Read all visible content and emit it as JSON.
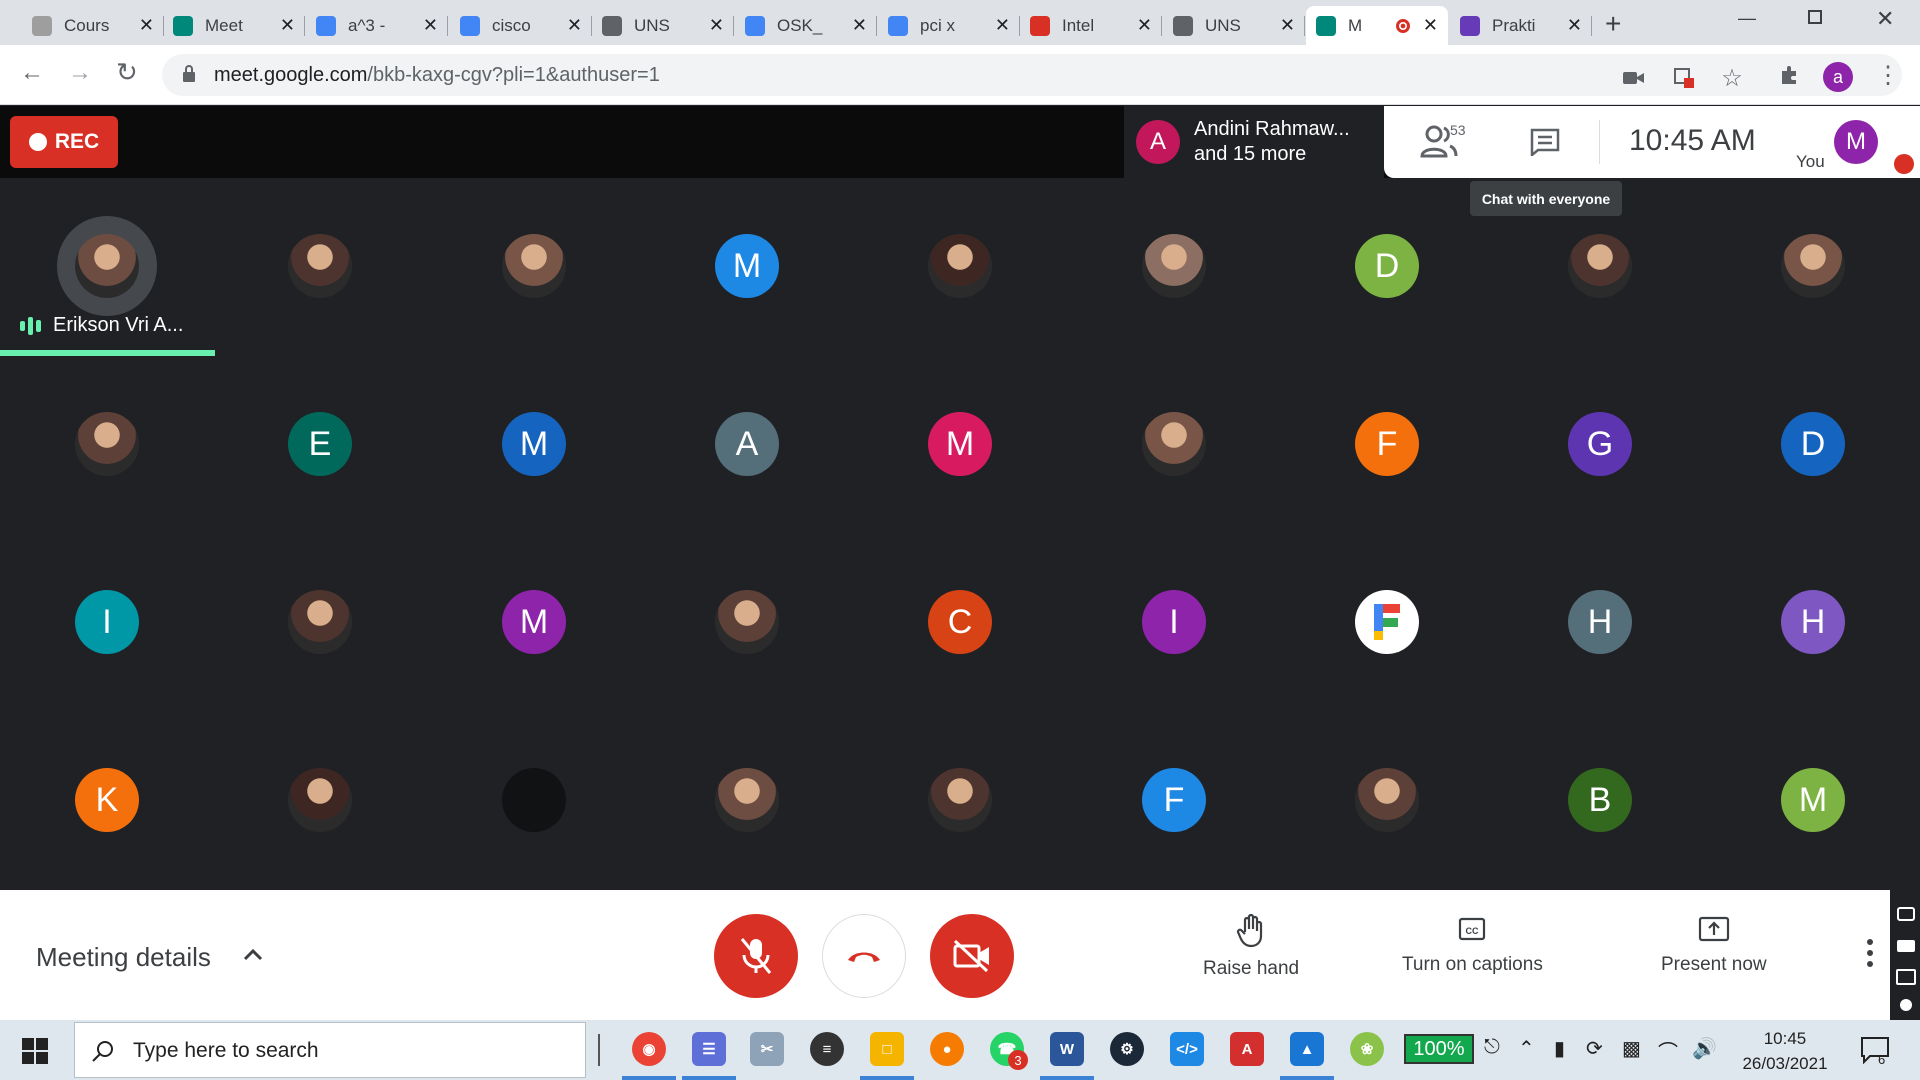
{
  "browser": {
    "tabs": [
      {
        "title": "Cours",
        "icon": "course-icon",
        "color": "#9e9e9e"
      },
      {
        "title": "Meet",
        "icon": "meet-icon",
        "color": "#00897b"
      },
      {
        "title": "a^3 -",
        "icon": "google-icon",
        "color": "#4285f4"
      },
      {
        "title": "cisco",
        "icon": "google-icon",
        "color": "#4285f4"
      },
      {
        "title": "UNS",
        "icon": "globe-icon",
        "color": "#5f6368"
      },
      {
        "title": "OSK_",
        "icon": "docs-icon",
        "color": "#4285f4"
      },
      {
        "title": "pci x",
        "icon": "google-icon",
        "color": "#4285f4"
      },
      {
        "title": "Intel",
        "icon": "t-icon",
        "color": "#d93025"
      },
      {
        "title": "UNS",
        "icon": "globe-icon",
        "color": "#5f6368"
      },
      {
        "title": "M",
        "icon": "meet-icon",
        "color": "#00897b",
        "recording": true
      },
      {
        "title": "Prakti",
        "icon": "forms-icon",
        "color": "#673ab7"
      }
    ],
    "url_main": "meet.google.com",
    "url_path": "/bkb-kaxg-cgv?pli=1&authuser=1",
    "profile_initial": "a"
  },
  "meet": {
    "rec_label": "REC",
    "presenter_initial": "A",
    "presenter_name": "Andini Rahmaw...",
    "presenter_more": "and 15 more",
    "people_count": "53",
    "time": "10:45 AM",
    "you_label": "You",
    "you_initial": "M",
    "tooltip": "Chat with everyone",
    "speaker_name": "Erikson Vri A...",
    "participants": [
      {
        "type": "photo"
      },
      {
        "type": "photo"
      },
      {
        "type": "photo"
      },
      {
        "initial": "M",
        "color": "#1e88e5"
      },
      {
        "type": "photo"
      },
      {
        "type": "photo"
      },
      {
        "initial": "D",
        "color": "#7cb342"
      },
      {
        "type": "photo"
      },
      {
        "type": "photo"
      },
      {
        "type": "photo"
      },
      {
        "initial": "E",
        "color": "#00695c"
      },
      {
        "initial": "M",
        "color": "#1565c0"
      },
      {
        "initial": "A",
        "color": "#546e7a"
      },
      {
        "initial": "M",
        "color": "#d81b60"
      },
      {
        "type": "photo"
      },
      {
        "initial": "F",
        "color": "#f4700c"
      },
      {
        "initial": "G",
        "color": "#5e35b1"
      },
      {
        "initial": "D",
        "color": "#1565c0"
      },
      {
        "initial": "I",
        "color": "#0097a7"
      },
      {
        "type": "photo"
      },
      {
        "initial": "M",
        "color": "#8e24aa"
      },
      {
        "type": "photo"
      },
      {
        "initial": "C",
        "color": "#d84315"
      },
      {
        "initial": "I",
        "color": "#8e24aa"
      },
      {
        "type": "logo"
      },
      {
        "initial": "H",
        "color": "#546e7a"
      },
      {
        "initial": "H",
        "color": "#7e57c2"
      },
      {
        "initial": "K",
        "color": "#f4700c"
      },
      {
        "type": "photo"
      },
      {
        "type": "dark"
      },
      {
        "type": "photo"
      },
      {
        "type": "photo"
      },
      {
        "initial": "F",
        "color": "#1e88e5"
      },
      {
        "type": "photo"
      },
      {
        "initial": "B",
        "color": "#33691e"
      },
      {
        "initial": "M",
        "color": "#7cb342"
      }
    ],
    "meeting_details": "Meeting details",
    "raise_hand": "Raise hand",
    "captions": "Turn on captions",
    "present": "Present now"
  },
  "taskbar": {
    "search_placeholder": "Type here to search",
    "battery": "100%",
    "time": "10:45",
    "date": "26/03/2021",
    "whatsapp_badge": "3",
    "notification_count": "6"
  }
}
